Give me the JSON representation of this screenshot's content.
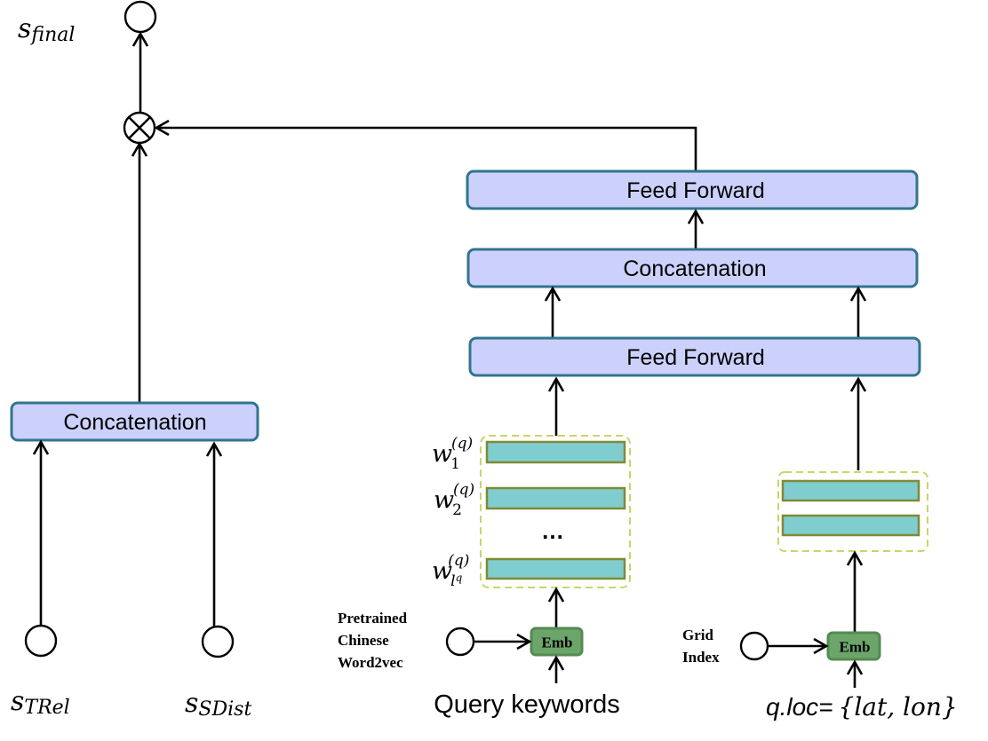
{
  "diagram": {
    "output_node": {
      "label_base": "s",
      "label_sub": "final"
    },
    "multiply_node": {
      "symbol": "⊗"
    },
    "left_branch": {
      "concat_label": "Concatenation",
      "inputs": [
        {
          "label_base": "s",
          "label_sub": "TRel"
        },
        {
          "label_base": "s",
          "label_sub": "SDist"
        }
      ]
    },
    "right_branch": {
      "feed_forward_top_label": "Feed Forward",
      "concat_label": "Concatenation",
      "feed_forward_bottom_label": "Feed Forward",
      "query_embeddings": {
        "words": [
          {
            "base": "w",
            "sub": "1",
            "sup": "(q)"
          },
          {
            "base": "w",
            "sub": "2",
            "sup": "(q)"
          },
          {
            "base": "w",
            "sub": "l",
            "subsup": "q",
            "sup": "(q)"
          }
        ],
        "ellipsis": "…"
      },
      "query_emb": {
        "label": "Emb",
        "source_label_lines": [
          "Pretrained",
          "Chinese",
          "Word2vec"
        ],
        "input_label": "Query keywords"
      },
      "location_emb": {
        "label": "Emb",
        "source_label_lines": [
          "Grid",
          "Index"
        ],
        "input_label_prefix": "q.loc=",
        "input_label_math": "{lat, lon}"
      }
    },
    "colors": {
      "box_fill": "#ccd1fb",
      "box_border": "#31758e",
      "emb_fill": "#6ca56a",
      "vector_fill": "#80cdd0",
      "vector_border": "#7f8b33",
      "group_dash": "#c9d56a"
    }
  }
}
